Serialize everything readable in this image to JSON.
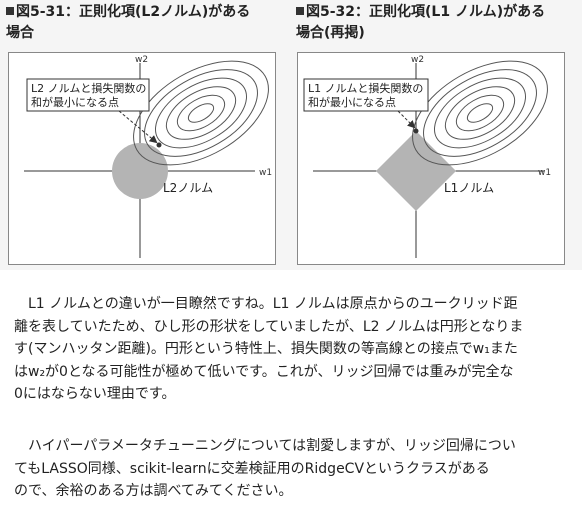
{
  "figures": [
    {
      "caption_line1": "図5-31：正則化項(L2ノルム)がある",
      "caption_line2": "場合",
      "callout_line1": "L2 ノルムと損失関数の",
      "callout_line2": "和が最小になる点",
      "axis_x": "w1",
      "axis_y": "w2",
      "shape_label": "L2ノルム"
    },
    {
      "caption_line1": "図5-32：正則化項(L1 ノルム)がある",
      "caption_line2": "場合(再掲)",
      "callout_line1": "L1 ノルムと損失関数の",
      "callout_line2": "和が最小になる点",
      "axis_x": "w1",
      "axis_y": "w2",
      "shape_label": "L1ノルム"
    }
  ],
  "paragraph1": [
    "L1 ノルムとの違いが一目瞭然ですね。L1 ノルムは原点からのユークリッド距",
    "離を表していたため、ひし形の形状をしていましたが、L2 ノルムは円形となりま",
    "す(マンハッタン距離)。円形という特性上、損失関数の等高線との接点でw₁また",
    "はw₂が0となる可能性が極めて低いです。これが、リッジ回帰では重みが完全な",
    "0にはならない理由です。"
  ],
  "paragraph2": [
    "ハイパーパラメータチューニングについては割愛しますが、リッジ回帰につい",
    "てもLASSO同様、scikit-learnに交差検証用のRidgeCVというクラスがある",
    "ので、余裕のある方は調べてみてください。"
  ],
  "colors": {
    "shape_fill": "#b4b4b4",
    "ellipse_stroke": "#555555",
    "figure_bg": "#f5f5f5"
  }
}
